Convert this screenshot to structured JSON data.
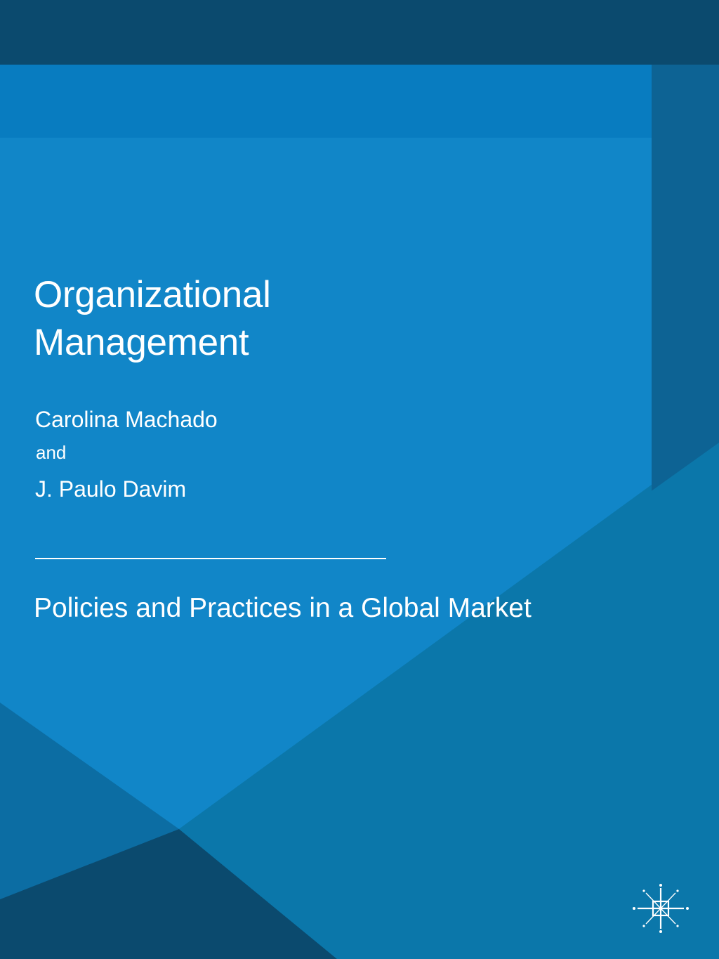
{
  "book": {
    "title_line1": "Organizational",
    "title_line2": "Management",
    "author_1": "Carolina Machado",
    "conjunction": "and",
    "author_2": "J. Paulo Davim",
    "subtitle": "Policies and Practices in a Global Market"
  },
  "colors": {
    "top_band": "#0b4a6e",
    "main_blue": "#1186c8",
    "upper_strip": "#087cc0",
    "right_panel": "#0d6394",
    "lower_right": "#0b77aa",
    "lower_left": "#0c6da3",
    "bottom_left_triangle": "#0b4a6e",
    "text": "#ffffff"
  },
  "publisher": {
    "logo_icon": "publisher-logo-icon"
  }
}
